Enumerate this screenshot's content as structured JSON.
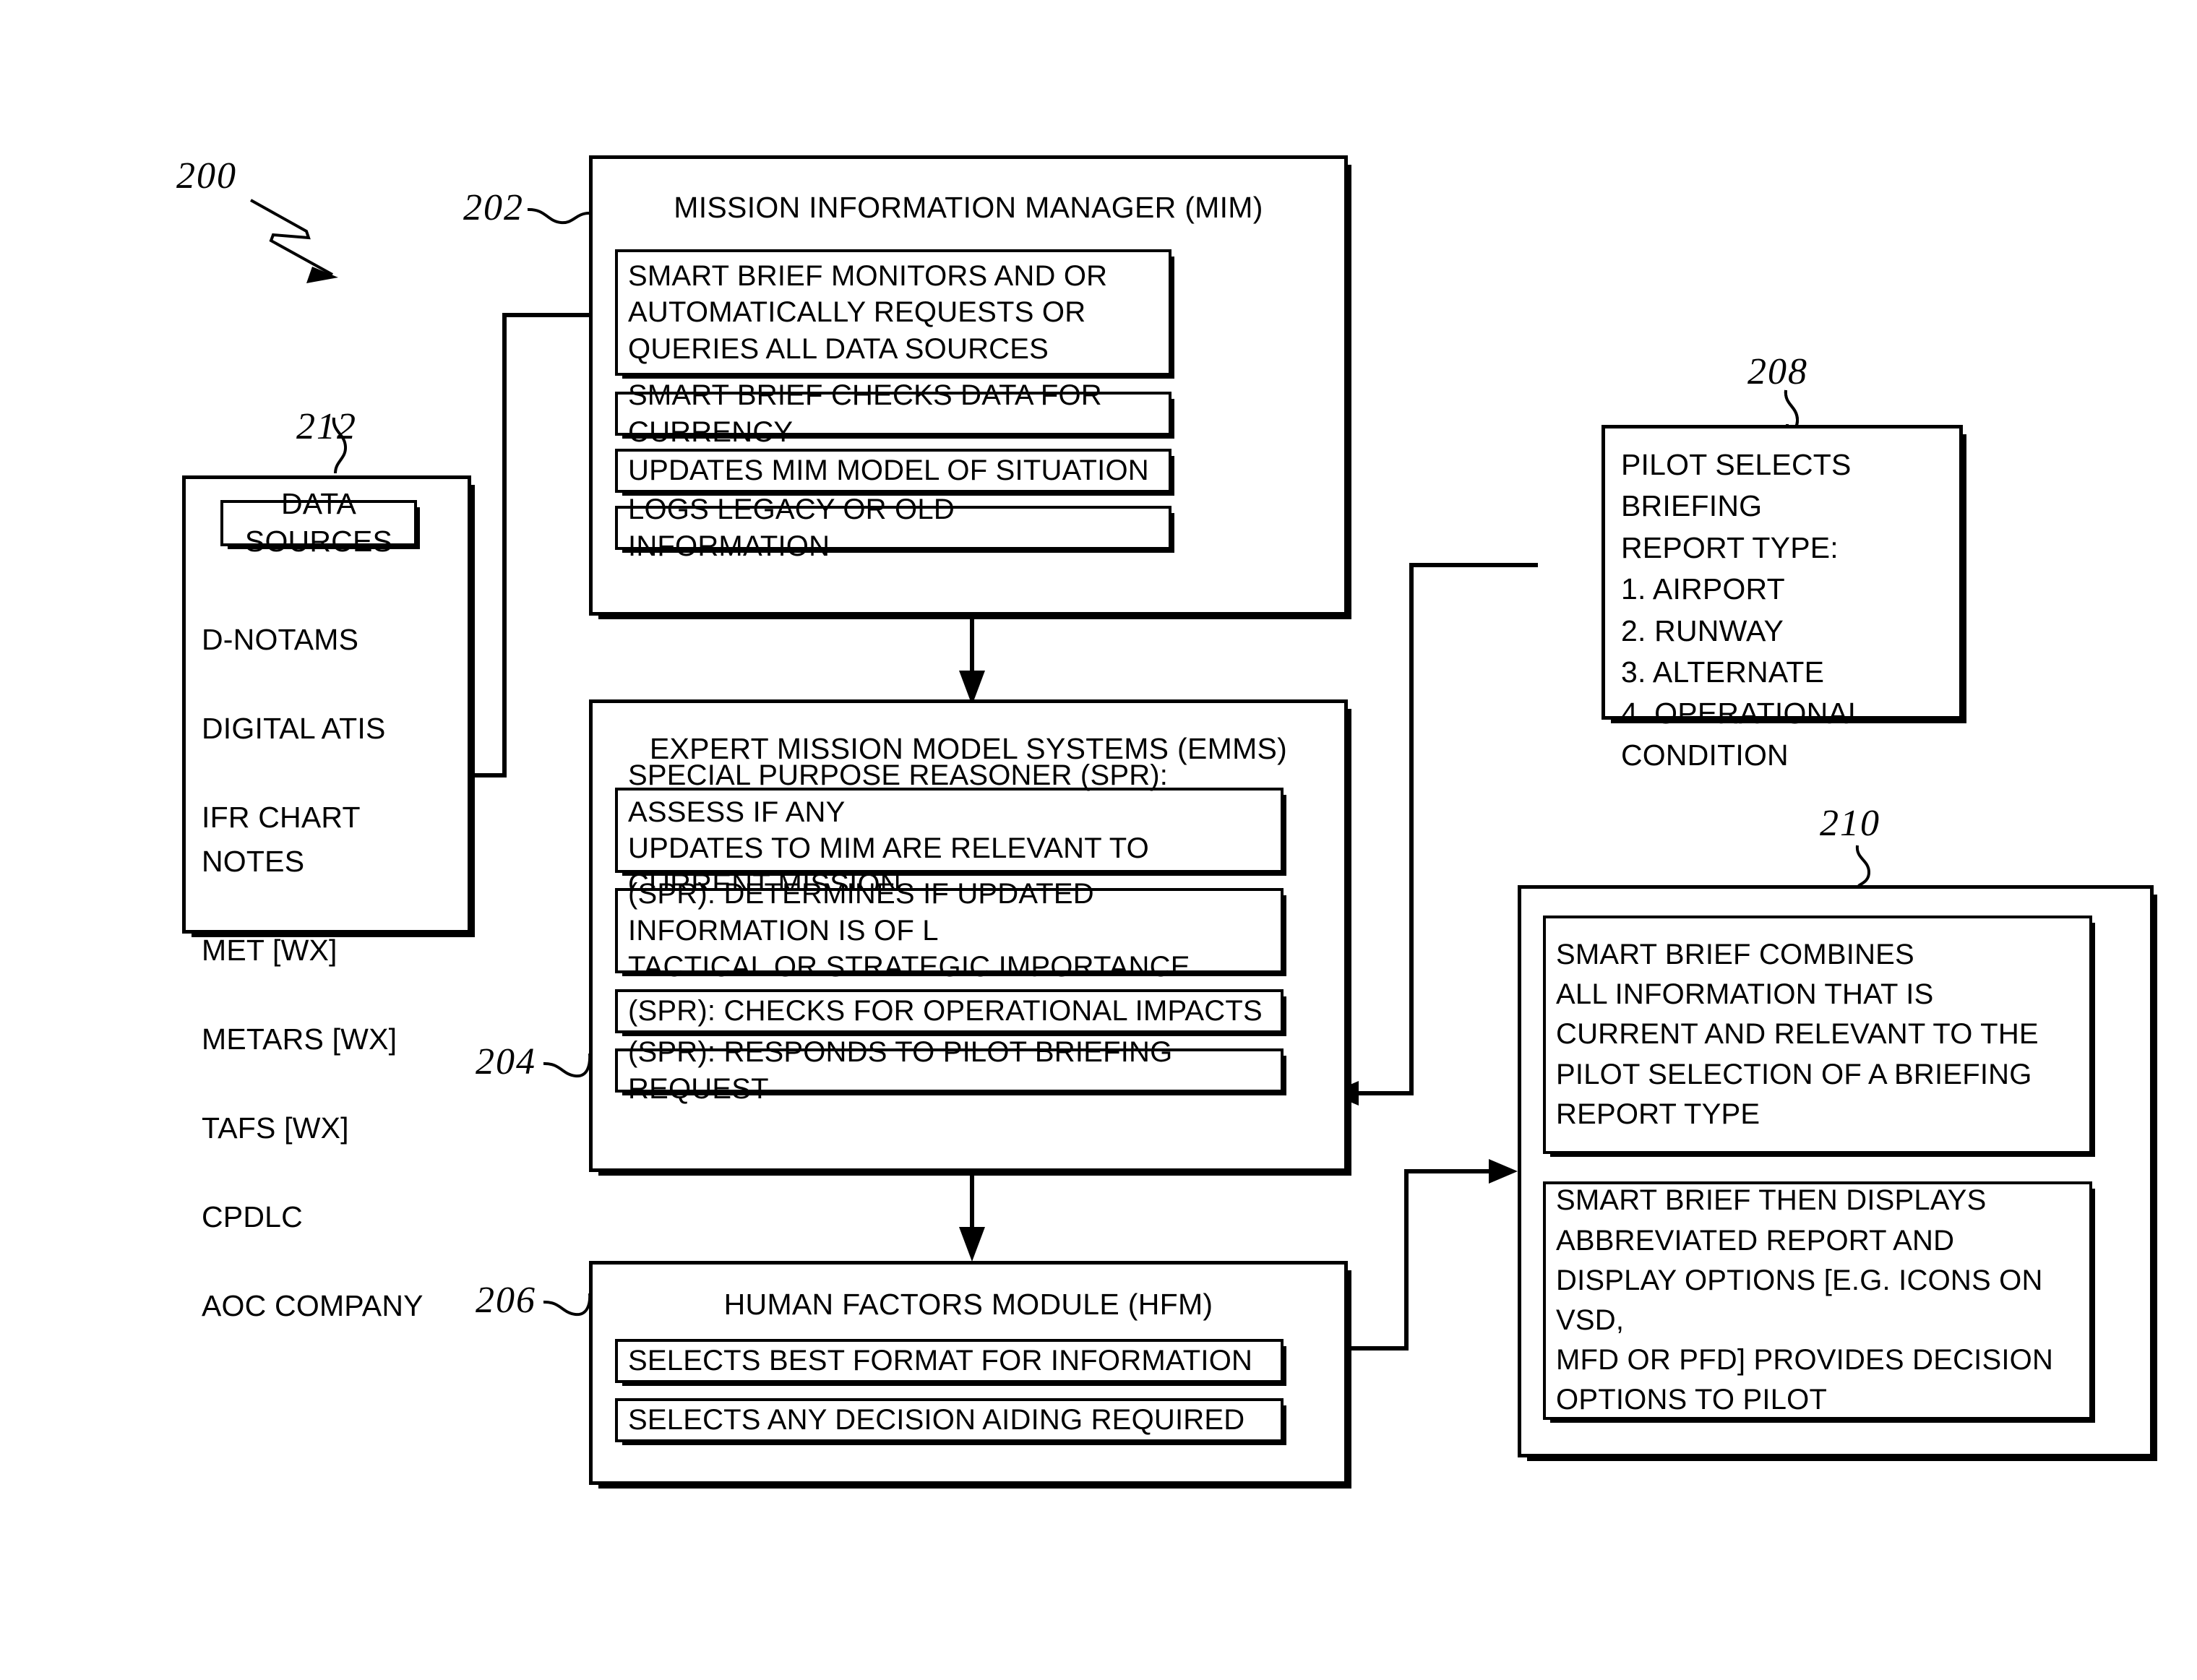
{
  "figure": {
    "number": "200",
    "refs": {
      "mim": "202",
      "emms": "204",
      "hfm": "206",
      "pilot_select": "208",
      "smart_brief_output": "210",
      "data_sources": "212"
    }
  },
  "data_sources_box": {
    "ref": "212",
    "heading": "DATA SOURCES",
    "items": [
      "D-NOTAMS",
      "DIGITAL ATIS",
      "IFR CHART NOTES",
      "MET [WX]",
      "METARS [WX]",
      "TAFS [WX]",
      "CPDLC",
      "AOC COMPANY"
    ]
  },
  "mim_box": {
    "ref": "202",
    "title": "MISSION INFORMATION MANAGER (MIM)",
    "steps": [
      "SMART BRIEF MONITORS AND OR\nAUTOMATICALLY REQUESTS OR\nQUERIES ALL DATA SOURCES",
      "SMART BRIEF CHECKS DATA FOR CURRENCY",
      "UPDATES MIM MODEL OF SITUATION",
      "LOGS LEGACY OR OLD INFORMATION"
    ]
  },
  "emms_box": {
    "ref": "204",
    "title": "EXPERT MISSION MODEL SYSTEMS (EMMS)",
    "steps": [
      "SPECIAL PURPOSE REASONER (SPR): ASSESS IF ANY\nUPDATES TO MIM ARE RELEVANT TO CURRENT MISSION",
      "(SPR): DETERMINES IF UPDATED INFORMATION IS OF L\nTACTICAL OR STRATEGIC IMPORTANCE",
      "(SPR): CHECKS FOR OPERATIONAL IMPACTS",
      "(SPR): RESPONDS TO PILOT BRIEFING REQUEST"
    ]
  },
  "hfm_box": {
    "ref": "206",
    "title": "HUMAN FACTORS MODULE (HFM)",
    "steps": [
      "SELECTS BEST FORMAT FOR INFORMATION",
      "SELECTS ANY DECISION AIDING REQUIRED"
    ]
  },
  "pilot_select_box": {
    "ref": "208",
    "text": "PILOT SELECTS BRIEFING\nREPORT TYPE:\n1. AIRPORT\n2. RUNWAY\n3. ALTERNATE\n4. OPERATIONAL CONDITION"
  },
  "smart_brief_output_box": {
    "ref": "210",
    "steps": [
      "SMART BRIEF COMBINES\nALL INFORMATION THAT IS\nCURRENT AND RELEVANT TO THE\nPILOT SELECTION OF A BRIEFING\nREPORT TYPE",
      "SMART BRIEF THEN DISPLAYS\nABBREVIATED REPORT AND\nDISPLAY OPTIONS [E.G. ICONS ON VSD,\nMFD OR PFD] PROVIDES DECISION\nOPTIONS TO PILOT"
    ]
  },
  "colors": {
    "ink": "#000000",
    "paper": "#ffffff"
  }
}
